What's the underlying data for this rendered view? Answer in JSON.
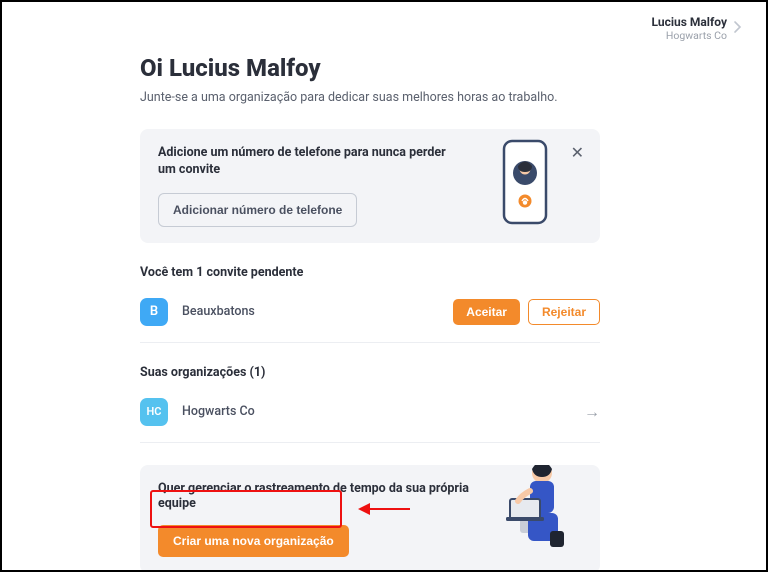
{
  "header": {
    "user_name": "Lucius Malfoy",
    "company": "Hogwarts Co"
  },
  "page": {
    "greeting": "Oi Lucius Malfoy",
    "subtitle": "Junte-se a uma organização para dedicar suas melhores horas ao trabalho."
  },
  "phone_banner": {
    "title": "Adicione um número de telefone para nunca perder um convite",
    "button": "Adicionar número de telefone"
  },
  "invites": {
    "title": "Você tem 1 convite pendente",
    "items": [
      {
        "initial": "B",
        "name": "Beauxbatons"
      }
    ],
    "accept": "Aceitar",
    "reject": "Rejeitar"
  },
  "orgs": {
    "title": "Suas organizações (1)",
    "items": [
      {
        "initial": "HC",
        "name": "Hogwarts Co"
      }
    ]
  },
  "create_banner": {
    "title": "Quer gerenciar o rastreamento de tempo da sua própria equipe",
    "button": "Criar uma nova organização"
  }
}
